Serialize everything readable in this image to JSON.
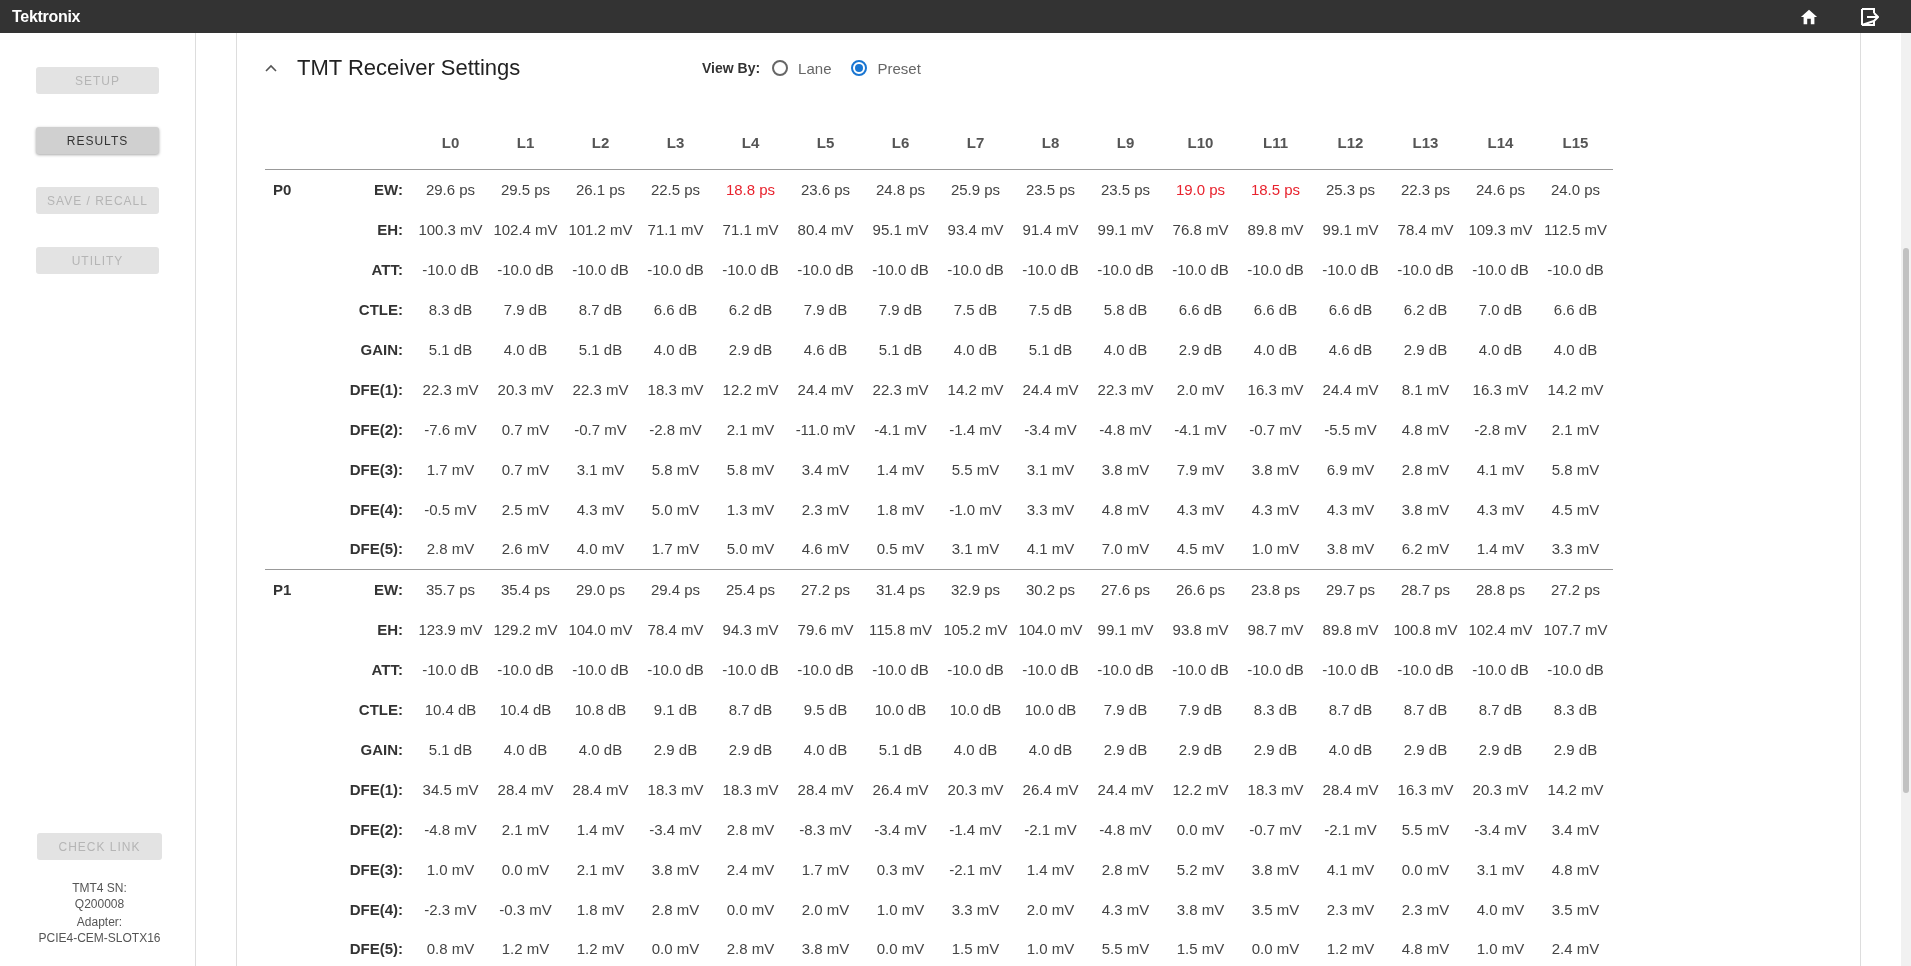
{
  "app": {
    "logo": "Tektronix"
  },
  "sidebar": {
    "items": [
      {
        "label": "SETUP",
        "selected": false
      },
      {
        "label": "RESULTS",
        "selected": true
      },
      {
        "label": "SAVE / RECALL",
        "selected": false
      },
      {
        "label": "UTILITY",
        "selected": false
      }
    ],
    "check_link": {
      "label": "CHECK LINK",
      "disabled": true
    },
    "info": [
      "TMT4 SN:",
      "Q200008",
      "Adapter:",
      "PCIE4-CEM-SLOTX16"
    ]
  },
  "panel": {
    "title": "TMT Receiver Settings",
    "expanded": true,
    "view_by": {
      "label": "View By:",
      "options": [
        {
          "label": "Lane",
          "selected": false
        },
        {
          "label": "Preset",
          "selected": true
        }
      ]
    },
    "table": {
      "columns": [
        "L0",
        "L1",
        "L2",
        "L3",
        "L4",
        "L5",
        "L6",
        "L7",
        "L8",
        "L9",
        "L10",
        "L11",
        "L12",
        "L13",
        "L14",
        "L15"
      ],
      "groups": [
        {
          "label": "P0",
          "rows": [
            {
              "label": "EW:",
              "values": [
                "29.6 ps",
                "29.5 ps",
                "26.1 ps",
                "22.5 ps",
                "18.8 ps",
                "23.6 ps",
                "24.8 ps",
                "25.9 ps",
                "23.5 ps",
                "23.5 ps",
                "19.0 ps",
                "18.5 ps",
                "25.3 ps",
                "22.3 ps",
                "24.6 ps",
                "24.0 ps"
              ],
              "alert": [
                false,
                false,
                false,
                false,
                true,
                false,
                false,
                false,
                false,
                false,
                true,
                true,
                false,
                false,
                false,
                false
              ]
            },
            {
              "label": "EH:",
              "values": [
                "100.3 mV",
                "102.4 mV",
                "101.2 mV",
                "71.1 mV",
                "71.1 mV",
                "80.4 mV",
                "95.1 mV",
                "93.4 mV",
                "91.4 mV",
                "99.1 mV",
                "76.8 mV",
                "89.8 mV",
                "99.1 mV",
                "78.4 mV",
                "109.3 mV",
                "112.5 mV"
              ],
              "alert": [
                false,
                false,
                false,
                false,
                false,
                false,
                false,
                false,
                false,
                false,
                false,
                false,
                false,
                false,
                false,
                false
              ]
            },
            {
              "label": "ATT:",
              "values": [
                "-10.0 dB",
                "-10.0 dB",
                "-10.0 dB",
                "-10.0 dB",
                "-10.0 dB",
                "-10.0 dB",
                "-10.0 dB",
                "-10.0 dB",
                "-10.0 dB",
                "-10.0 dB",
                "-10.0 dB",
                "-10.0 dB",
                "-10.0 dB",
                "-10.0 dB",
                "-10.0 dB",
                "-10.0 dB"
              ],
              "alert": [
                false,
                false,
                false,
                false,
                false,
                false,
                false,
                false,
                false,
                false,
                false,
                false,
                false,
                false,
                false,
                false
              ]
            },
            {
              "label": "CTLE:",
              "values": [
                "8.3 dB",
                "7.9 dB",
                "8.7 dB",
                "6.6 dB",
                "6.2 dB",
                "7.9 dB",
                "7.9 dB",
                "7.5 dB",
                "7.5 dB",
                "5.8 dB",
                "6.6 dB",
                "6.6 dB",
                "6.6 dB",
                "6.2 dB",
                "7.0 dB",
                "6.6 dB"
              ],
              "alert": [
                false,
                false,
                false,
                false,
                false,
                false,
                false,
                false,
                false,
                false,
                false,
                false,
                false,
                false,
                false,
                false
              ]
            },
            {
              "label": "GAIN:",
              "values": [
                "5.1 dB",
                "4.0 dB",
                "5.1 dB",
                "4.0 dB",
                "2.9 dB",
                "4.6 dB",
                "5.1 dB",
                "4.0 dB",
                "5.1 dB",
                "4.0 dB",
                "2.9 dB",
                "4.0 dB",
                "4.6 dB",
                "2.9 dB",
                "4.0 dB",
                "4.0 dB"
              ],
              "alert": [
                false,
                false,
                false,
                false,
                false,
                false,
                false,
                false,
                false,
                false,
                false,
                false,
                false,
                false,
                false,
                false
              ]
            },
            {
              "label": "DFE(1):",
              "values": [
                "22.3 mV",
                "20.3 mV",
                "22.3 mV",
                "18.3 mV",
                "12.2 mV",
                "24.4 mV",
                "22.3 mV",
                "14.2 mV",
                "24.4 mV",
                "22.3 mV",
                "2.0 mV",
                "16.3 mV",
                "24.4 mV",
                "8.1 mV",
                "16.3 mV",
                "14.2 mV"
              ],
              "alert": [
                false,
                false,
                false,
                false,
                false,
                false,
                false,
                false,
                false,
                false,
                false,
                false,
                false,
                false,
                false,
                false
              ]
            },
            {
              "label": "DFE(2):",
              "values": [
                "-7.6 mV",
                "0.7 mV",
                "-0.7 mV",
                "-2.8 mV",
                "2.1 mV",
                "-11.0 mV",
                "-4.1 mV",
                "-1.4 mV",
                "-3.4 mV",
                "-4.8 mV",
                "-4.1 mV",
                "-0.7 mV",
                "-5.5 mV",
                "4.8 mV",
                "-2.8 mV",
                "2.1 mV"
              ],
              "alert": [
                false,
                false,
                false,
                false,
                false,
                false,
                false,
                false,
                false,
                false,
                false,
                false,
                false,
                false,
                false,
                false
              ]
            },
            {
              "label": "DFE(3):",
              "values": [
                "1.7 mV",
                "0.7 mV",
                "3.1 mV",
                "5.8 mV",
                "5.8 mV",
                "3.4 mV",
                "1.4 mV",
                "5.5 mV",
                "3.1 mV",
                "3.8 mV",
                "7.9 mV",
                "3.8 mV",
                "6.9 mV",
                "2.8 mV",
                "4.1 mV",
                "5.8 mV"
              ],
              "alert": [
                false,
                false,
                false,
                false,
                false,
                false,
                false,
                false,
                false,
                false,
                false,
                false,
                false,
                false,
                false,
                false
              ]
            },
            {
              "label": "DFE(4):",
              "values": [
                "-0.5 mV",
                "2.5 mV",
                "4.3 mV",
                "5.0 mV",
                "1.3 mV",
                "2.3 mV",
                "1.8 mV",
                "-1.0 mV",
                "3.3 mV",
                "4.8 mV",
                "4.3 mV",
                "4.3 mV",
                "4.3 mV",
                "3.8 mV",
                "4.3 mV",
                "4.5 mV"
              ],
              "alert": [
                false,
                false,
                false,
                false,
                false,
                false,
                false,
                false,
                false,
                false,
                false,
                false,
                false,
                false,
                false,
                false
              ]
            },
            {
              "label": "DFE(5):",
              "values": [
                "2.8 mV",
                "2.6 mV",
                "4.0 mV",
                "1.7 mV",
                "5.0 mV",
                "4.6 mV",
                "0.5 mV",
                "3.1 mV",
                "4.1 mV",
                "7.0 mV",
                "4.5 mV",
                "1.0 mV",
                "3.8 mV",
                "6.2 mV",
                "1.4 mV",
                "3.3 mV"
              ],
              "alert": [
                false,
                false,
                false,
                false,
                false,
                false,
                false,
                false,
                false,
                false,
                false,
                false,
                false,
                false,
                false,
                false
              ]
            }
          ]
        },
        {
          "label": "P1",
          "rows": [
            {
              "label": "EW:",
              "values": [
                "35.7 ps",
                "35.4 ps",
                "29.0 ps",
                "29.4 ps",
                "25.4 ps",
                "27.2 ps",
                "31.4 ps",
                "32.9 ps",
                "30.2 ps",
                "27.6 ps",
                "26.6 ps",
                "23.8 ps",
                "29.7 ps",
                "28.7 ps",
                "28.8 ps",
                "27.2 ps"
              ],
              "alert": [
                false,
                false,
                false,
                false,
                false,
                false,
                false,
                false,
                false,
                false,
                false,
                false,
                false,
                false,
                false,
                false
              ]
            },
            {
              "label": "EH:",
              "values": [
                "123.9 mV",
                "129.2 mV",
                "104.0 mV",
                "78.4 mV",
                "94.3 mV",
                "79.6 mV",
                "115.8 mV",
                "105.2 mV",
                "104.0 mV",
                "99.1 mV",
                "93.8 mV",
                "98.7 mV",
                "89.8 mV",
                "100.8 mV",
                "102.4 mV",
                "107.7 mV"
              ],
              "alert": [
                false,
                false,
                false,
                false,
                false,
                false,
                false,
                false,
                false,
                false,
                false,
                false,
                false,
                false,
                false,
                false
              ]
            },
            {
              "label": "ATT:",
              "values": [
                "-10.0 dB",
                "-10.0 dB",
                "-10.0 dB",
                "-10.0 dB",
                "-10.0 dB",
                "-10.0 dB",
                "-10.0 dB",
                "-10.0 dB",
                "-10.0 dB",
                "-10.0 dB",
                "-10.0 dB",
                "-10.0 dB",
                "-10.0 dB",
                "-10.0 dB",
                "-10.0 dB",
                "-10.0 dB"
              ],
              "alert": [
                false,
                false,
                false,
                false,
                false,
                false,
                false,
                false,
                false,
                false,
                false,
                false,
                false,
                false,
                false,
                false
              ]
            },
            {
              "label": "CTLE:",
              "values": [
                "10.4 dB",
                "10.4 dB",
                "10.8 dB",
                "9.1 dB",
                "8.7 dB",
                "9.5 dB",
                "10.0 dB",
                "10.0 dB",
                "10.0 dB",
                "7.9 dB",
                "7.9 dB",
                "8.3 dB",
                "8.7 dB",
                "8.7 dB",
                "8.7 dB",
                "8.3 dB"
              ],
              "alert": [
                false,
                false,
                false,
                false,
                false,
                false,
                false,
                false,
                false,
                false,
                false,
                false,
                false,
                false,
                false,
                false
              ]
            },
            {
              "label": "GAIN:",
              "values": [
                "5.1 dB",
                "4.0 dB",
                "4.0 dB",
                "2.9 dB",
                "2.9 dB",
                "4.0 dB",
                "5.1 dB",
                "4.0 dB",
                "4.0 dB",
                "2.9 dB",
                "2.9 dB",
                "2.9 dB",
                "4.0 dB",
                "2.9 dB",
                "2.9 dB",
                "2.9 dB"
              ],
              "alert": [
                false,
                false,
                false,
                false,
                false,
                false,
                false,
                false,
                false,
                false,
                false,
                false,
                false,
                false,
                false,
                false
              ]
            },
            {
              "label": "DFE(1):",
              "values": [
                "34.5 mV",
                "28.4 mV",
                "28.4 mV",
                "18.3 mV",
                "18.3 mV",
                "28.4 mV",
                "26.4 mV",
                "20.3 mV",
                "26.4 mV",
                "24.4 mV",
                "12.2 mV",
                "18.3 mV",
                "28.4 mV",
                "16.3 mV",
                "20.3 mV",
                "14.2 mV"
              ],
              "alert": [
                false,
                false,
                false,
                false,
                false,
                false,
                false,
                false,
                false,
                false,
                false,
                false,
                false,
                false,
                false,
                false
              ]
            },
            {
              "label": "DFE(2):",
              "values": [
                "-4.8 mV",
                "2.1 mV",
                "1.4 mV",
                "-3.4 mV",
                "2.8 mV",
                "-8.3 mV",
                "-3.4 mV",
                "-1.4 mV",
                "-2.1 mV",
                "-4.8 mV",
                "0.0 mV",
                "-0.7 mV",
                "-2.1 mV",
                "5.5 mV",
                "-3.4 mV",
                "3.4 mV"
              ],
              "alert": [
                false,
                false,
                false,
                false,
                false,
                false,
                false,
                false,
                false,
                false,
                false,
                false,
                false,
                false,
                false,
                false
              ]
            },
            {
              "label": "DFE(3):",
              "values": [
                "1.0 mV",
                "0.0 mV",
                "2.1 mV",
                "3.8 mV",
                "2.4 mV",
                "1.7 mV",
                "0.3 mV",
                "-2.1 mV",
                "1.4 mV",
                "2.8 mV",
                "5.2 mV",
                "3.8 mV",
                "4.1 mV",
                "0.0 mV",
                "3.1 mV",
                "4.8 mV"
              ],
              "alert": [
                false,
                false,
                false,
                false,
                false,
                false,
                false,
                false,
                false,
                false,
                false,
                false,
                false,
                false,
                false,
                false
              ]
            },
            {
              "label": "DFE(4):",
              "values": [
                "-2.3 mV",
                "-0.3 mV",
                "1.8 mV",
                "2.8 mV",
                "0.0 mV",
                "2.0 mV",
                "1.0 mV",
                "3.3 mV",
                "2.0 mV",
                "4.3 mV",
                "3.8 mV",
                "3.5 mV",
                "2.3 mV",
                "2.3 mV",
                "4.0 mV",
                "3.5 mV"
              ],
              "alert": [
                false,
                false,
                false,
                false,
                false,
                false,
                false,
                false,
                false,
                false,
                false,
                false,
                false,
                false,
                false,
                false
              ]
            },
            {
              "label": "DFE(5):",
              "values": [
                "0.8 mV",
                "1.2 mV",
                "1.2 mV",
                "0.0 mV",
                "2.8 mV",
                "3.8 mV",
                "0.0 mV",
                "1.5 mV",
                "1.0 mV",
                "5.5 mV",
                "1.5 mV",
                "0.0 mV",
                "1.2 mV",
                "4.8 mV",
                "1.0 mV",
                "2.4 mV"
              ],
              "alert": [
                false,
                false,
                false,
                false,
                false,
                false,
                false,
                false,
                false,
                false,
                false,
                false,
                false,
                false,
                false,
                false
              ]
            }
          ]
        }
      ]
    }
  }
}
